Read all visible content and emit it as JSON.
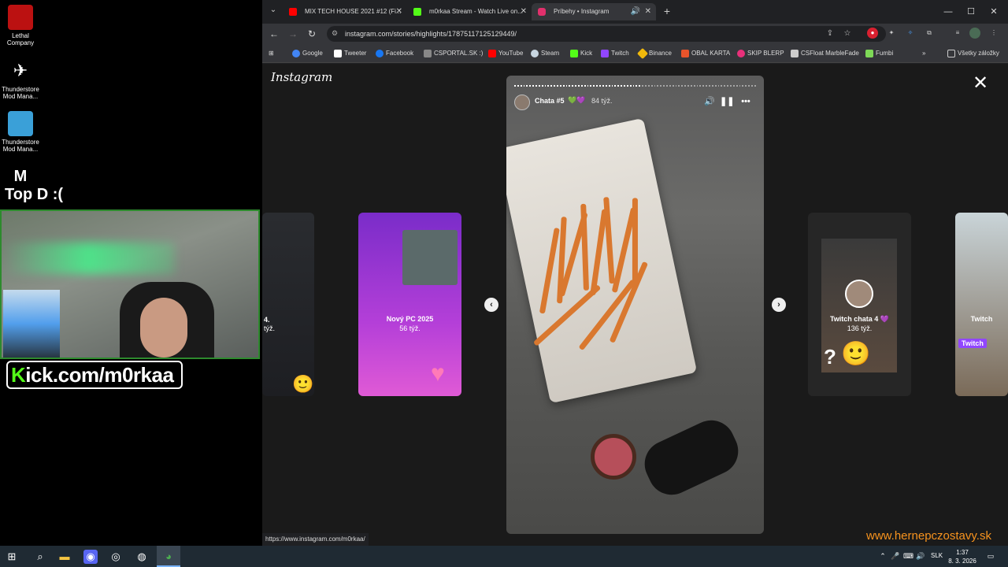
{
  "desktop": {
    "icons": [
      {
        "label": "Lethal Company"
      },
      {
        "label": "Thunderstore Mod Mana..."
      },
      {
        "label": "Thunderstore Mod Mana..."
      }
    ],
    "webcam_title": "Top D :(",
    "kick_banner": "Kick.com/m0rkaa"
  },
  "browser": {
    "tabs": [
      {
        "title": "MIX TECH HOUSE 2021 #12 (Fi...",
        "favicon_color": "#ff0000"
      },
      {
        "title": "m0rkaa Stream - Watch Live on...",
        "favicon_color": "#53fc18"
      },
      {
        "title": "Príbehy • Instagram",
        "favicon_color": "#e1306c",
        "active": true
      }
    ],
    "url": "instagram.com/stories/highlights/17875117125129449/",
    "bookmarks": [
      {
        "label": "Google",
        "color": "#4285f4"
      },
      {
        "label": "Tweeter",
        "color": "#ffffff"
      },
      {
        "label": "Facebook",
        "color": "#1877f2"
      },
      {
        "label": "CSPORTAL.SK :)",
        "color": "#888888"
      },
      {
        "label": "YouTube",
        "color": "#ff0000"
      },
      {
        "label": "Steam",
        "color": "#c7d5e0"
      },
      {
        "label": "Kick",
        "color": "#53fc18"
      },
      {
        "label": "Twitch",
        "color": "#9146ff"
      },
      {
        "label": "Binance",
        "color": "#f0b90b"
      },
      {
        "label": "OBAL KARTA",
        "color": "#e8542b"
      },
      {
        "label": "SKIP BLERP",
        "color": "#e8307a"
      },
      {
        "label": "CSFloat MarbleFade",
        "color": "#cccccc"
      },
      {
        "label": "Fumbi",
        "color": "#7ed957"
      }
    ],
    "all_bookmarks": "Všetky záložky",
    "status_url": "https://www.instagram.com/m0rkaa/"
  },
  "instagram": {
    "logo": "Instagram",
    "story": {
      "user": "Chata #5",
      "emoji": "💚💜",
      "time": "84 týž."
    },
    "left_card": {
      "title": "4.",
      "time": "týž."
    },
    "card_prev": {
      "title": "Nový PC 2025",
      "time": "56 týž."
    },
    "card_next": {
      "title": "Twitch chata 4 💜",
      "time": "136 týž."
    },
    "card_far": {
      "title": "Twitch"
    }
  },
  "watermark": "www.hernepczostavy.sk",
  "taskbar": {
    "lang": "SLK",
    "time": "1:37",
    "date": "8. 3. 2026"
  }
}
